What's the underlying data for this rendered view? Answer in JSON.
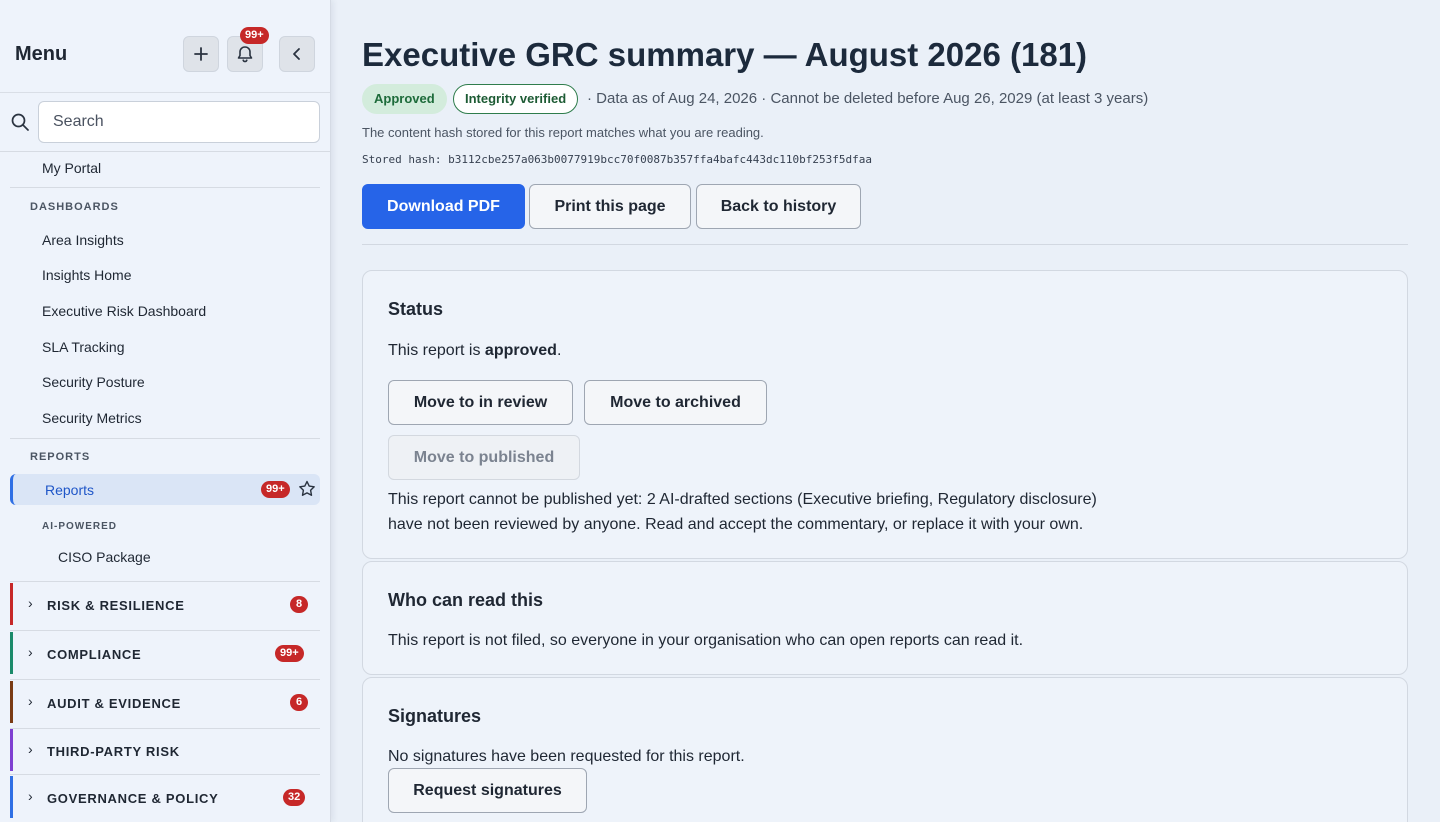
{
  "sidebar": {
    "title": "Menu",
    "notifications_badge": "99+",
    "search_placeholder": "Search",
    "my_portal": "My Portal",
    "dashboards_label": "DASHBOARDS",
    "dashboards": [
      "Area Insights",
      "Insights Home",
      "Executive Risk Dashboard",
      "SLA Tracking",
      "Security Posture",
      "Security Metrics"
    ],
    "reports_label": "REPORTS",
    "reports_item": {
      "label": "Reports",
      "badge": "99+"
    },
    "ai_label": "AI-POWERED",
    "ai_item": "CISO Package",
    "groups": [
      {
        "label": "RISK & RESILIENCE",
        "badge": "8",
        "color": "#c62828"
      },
      {
        "label": "COMPLIANCE",
        "badge": "99+",
        "color": "#1a8a6a"
      },
      {
        "label": "AUDIT & EVIDENCE",
        "badge": "6",
        "color": "#7a3b14"
      },
      {
        "label": "THIRD-PARTY RISK",
        "badge": "",
        "color": "#7e3fd1"
      },
      {
        "label": "GOVERNANCE & POLICY",
        "badge": "32",
        "color": "#2f6fe4"
      }
    ]
  },
  "report": {
    "title": "Executive GRC summary — August 2026 (181)",
    "status_pill": "Approved",
    "integrity_pill": "Integrity verified",
    "meta": "·  Data as of Aug 24, 2026  ·  Cannot be deleted before Aug 26, 2029 (at least 3 years)",
    "hash_note": "The content hash stored for this report matches what you are reading.",
    "hash_line": "Stored hash: b3112cbe257a063b0077919bcc70f0087b357ffa4bafc443dc110bf253f5dfaa",
    "actions": {
      "download": "Download PDF",
      "print": "Print this page",
      "back": "Back to history"
    }
  },
  "status_card": {
    "title": "Status",
    "text_prefix": "This report is ",
    "text_status": "approved",
    "text_suffix": ".",
    "btn_review": "Move to in review",
    "btn_archived": "Move to archived",
    "btn_published": "Move to published",
    "warning_line1": "This report cannot be published yet: 2 AI-drafted sections (Executive briefing, Regulatory disclosure)",
    "warning_line2": "have not been reviewed by anyone. Read and accept the commentary, or replace it with your own."
  },
  "read_card": {
    "title": "Who can read this",
    "text": "This report is not filed, so everyone in your organisation who can open reports can read it."
  },
  "sign_card": {
    "title": "Signatures",
    "text": "No signatures have been requested for this report.",
    "btn_request": "Request signatures"
  }
}
